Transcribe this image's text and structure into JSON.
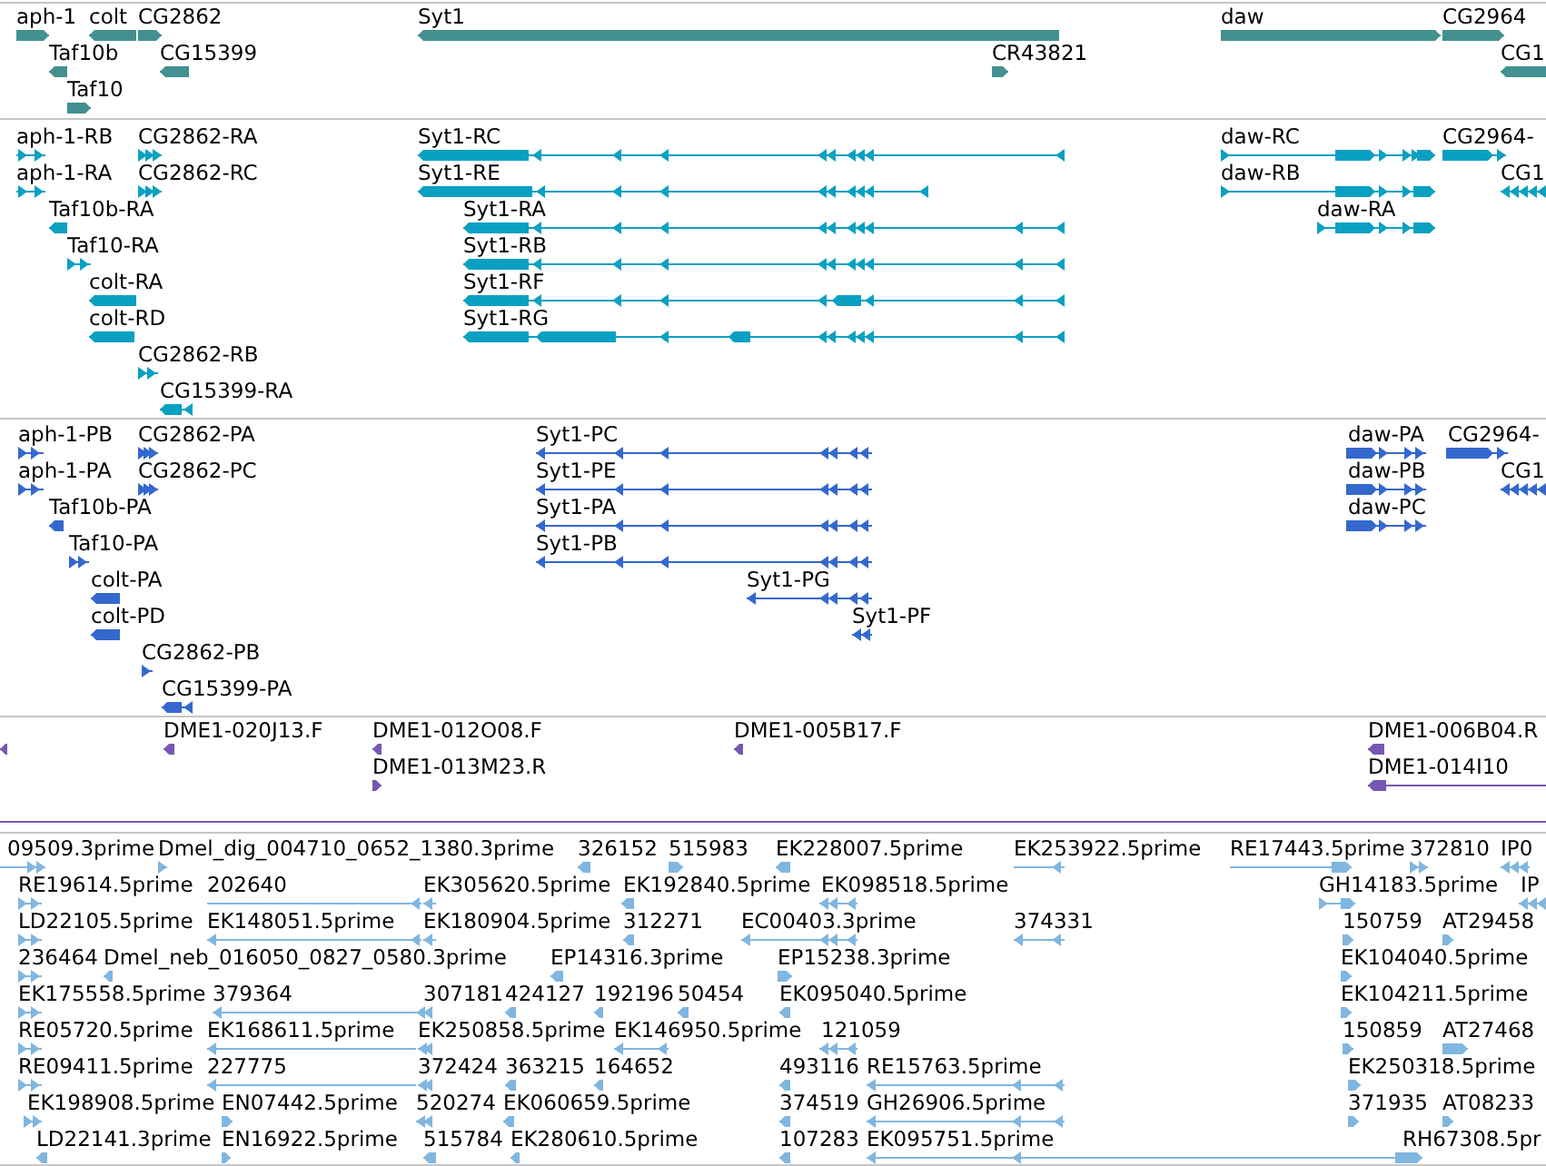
{
  "tracks": [
    {
      "kind": "gene",
      "features": [
        {
          "label": "aph-1",
          "reverse": false
        },
        {
          "label": "colt",
          "reverse": true
        },
        {
          "label": "CG2862",
          "reverse": false
        },
        {
          "label": "Syt1",
          "reverse": true
        },
        {
          "label": "daw",
          "reverse": false
        },
        {
          "label": "CG2964",
          "reverse": false
        },
        {
          "label": "Taf10b",
          "reverse": true
        },
        {
          "label": "CG15399",
          "reverse": true
        },
        {
          "label": "CR43821",
          "reverse": false
        },
        {
          "label": "CG1",
          "reverse": true
        },
        {
          "label": "Taf10",
          "reverse": false
        }
      ]
    },
    {
      "kind": "mrna",
      "features": [
        {
          "label": "aph-1-RB",
          "reverse": false
        },
        {
          "label": "CG2862-RA",
          "reverse": false
        },
        {
          "label": "Syt1-RC",
          "reverse": true
        },
        {
          "label": "daw-RC",
          "reverse": false
        },
        {
          "label": "CG2964-",
          "reverse": false
        },
        {
          "label": "aph-1-RA",
          "reverse": false
        },
        {
          "label": "CG2862-RC",
          "reverse": false
        },
        {
          "label": "Syt1-RE",
          "reverse": true
        },
        {
          "label": "daw-RB",
          "reverse": false
        },
        {
          "label": "CG1",
          "reverse": true
        },
        {
          "label": "Taf10b-RA",
          "reverse": true
        },
        {
          "label": "Syt1-RA",
          "reverse": true
        },
        {
          "label": "daw-RA",
          "reverse": false
        },
        {
          "label": "Taf10-RA",
          "reverse": false
        },
        {
          "label": "Syt1-RB",
          "reverse": true
        },
        {
          "label": "colt-RA",
          "reverse": true
        },
        {
          "label": "Syt1-RF",
          "reverse": true
        },
        {
          "label": "colt-RD",
          "reverse": true
        },
        {
          "label": "Syt1-RG",
          "reverse": true
        },
        {
          "label": "CG2862-RB",
          "reverse": false
        },
        {
          "label": "CG15399-RA",
          "reverse": true
        }
      ]
    },
    {
      "kind": "protein",
      "features": [
        {
          "label": "aph-1-PB",
          "reverse": false
        },
        {
          "label": "CG2862-PA",
          "reverse": false
        },
        {
          "label": "Syt1-PC",
          "reverse": true
        },
        {
          "label": "daw-PA",
          "reverse": false
        },
        {
          "label": "CG2964-",
          "reverse": false
        },
        {
          "label": "aph-1-PA",
          "reverse": false
        },
        {
          "label": "CG2862-PC",
          "reverse": false
        },
        {
          "label": "Syt1-PE",
          "reverse": true
        },
        {
          "label": "daw-PB",
          "reverse": false
        },
        {
          "label": "CG1",
          "reverse": true
        },
        {
          "label": "Taf10b-PA",
          "reverse": true
        },
        {
          "label": "Syt1-PA",
          "reverse": true
        },
        {
          "label": "daw-PC",
          "reverse": false
        },
        {
          "label": "Taf10-PA",
          "reverse": false
        },
        {
          "label": "Syt1-PB",
          "reverse": true
        },
        {
          "label": "colt-PA",
          "reverse": true
        },
        {
          "label": "Syt1-PG",
          "reverse": true
        },
        {
          "label": "colt-PD",
          "reverse": true
        },
        {
          "label": "Syt1-PF",
          "reverse": true
        },
        {
          "label": "CG2862-PB",
          "reverse": false
        },
        {
          "label": "CG15399-PA",
          "reverse": true
        }
      ]
    },
    {
      "kind": "clone_end",
      "features": [
        {
          "reverse": true
        },
        {
          "label": "DME1-020J13.F",
          "reverse": true
        },
        {
          "label": "DME1-012O08.F",
          "reverse": true
        },
        {
          "label": "DME1-005B17.F",
          "reverse": true
        },
        {
          "label": "DME1-006B04.R",
          "reverse": true
        },
        {
          "label": "DME1-013M23.R",
          "reverse": false
        },
        {
          "label": "DME1-014I10",
          "reverse": true
        }
      ]
    },
    {
      "kind": "est",
      "features": [
        {
          "label": "09509.3prime",
          "reverse": false
        },
        {
          "label": "Dmel_dig_004710_0652_1380.3prime",
          "reverse": false
        },
        {
          "label": "326152",
          "reverse": true
        },
        {
          "label": "515983",
          "reverse": false
        },
        {
          "label": "EK228007.5prime",
          "reverse": true
        },
        {
          "label": "EK253922.5prime",
          "reverse": true
        },
        {
          "label": "RE17443.5prime",
          "reverse": false
        },
        {
          "label": "372810",
          "reverse": false
        },
        {
          "label": "IP0",
          "reverse": true
        },
        {
          "label": "RE19614.5prime",
          "reverse": false
        },
        {
          "label": "202640",
          "reverse": true
        },
        {
          "label": "EK305620.5prime",
          "reverse": true
        },
        {
          "label": "EK192840.5prime",
          "reverse": true
        },
        {
          "label": "EK098518.5prime",
          "reverse": true
        },
        {
          "label": "GH14183.5prime",
          "reverse": false
        },
        {
          "label": "IP",
          "reverse": true
        },
        {
          "label": "LD22105.5prime",
          "reverse": false
        },
        {
          "label": "EK148051.5prime",
          "reverse": true
        },
        {
          "label": "EK180904.5prime",
          "reverse": true
        },
        {
          "label": "312271",
          "reverse": true
        },
        {
          "label": "EC00403.3prime",
          "reverse": true
        },
        {
          "label": "374331",
          "reverse": true
        },
        {
          "label": "150759",
          "reverse": false
        },
        {
          "label": "AT29458",
          "reverse": false
        },
        {
          "label": "236464",
          "reverse": false
        },
        {
          "label": "Dmel_neb_016050_0827_0580.3prime",
          "reverse": true
        },
        {
          "label": "EP14316.3prime",
          "reverse": true
        },
        {
          "label": "EP15238.3prime",
          "reverse": false
        },
        {
          "label": "EK104040.5prime",
          "reverse": false
        },
        {
          "label": "EK175558.5prime",
          "reverse": false
        },
        {
          "label": "379364",
          "reverse": true
        },
        {
          "label": "307181",
          "reverse": true
        },
        {
          "label": "424127",
          "reverse": true
        },
        {
          "label": "192196",
          "reverse": true
        },
        {
          "label": "50454",
          "reverse": true
        },
        {
          "label": "EK095040.5prime",
          "reverse": true
        },
        {
          "label": "EK104211.5prime",
          "reverse": false
        },
        {
          "label": "RE05720.5prime",
          "reverse": false
        },
        {
          "label": "EK168611.5prime",
          "reverse": true
        },
        {
          "label": "EK250858.5prime",
          "reverse": true
        },
        {
          "label": "EK146950.5prime",
          "reverse": true
        },
        {
          "label": "121059",
          "reverse": true
        },
        {
          "label": "150859",
          "reverse": false
        },
        {
          "label": "AT27468",
          "reverse": false
        },
        {
          "label": "RE09411.5prime",
          "reverse": false
        },
        {
          "label": "227775",
          "reverse": true
        },
        {
          "label": "372424",
          "reverse": true
        },
        {
          "label": "363215",
          "reverse": true
        },
        {
          "label": "164652",
          "reverse": true
        },
        {
          "label": "493116",
          "reverse": true
        },
        {
          "label": "RE15763.5prime",
          "reverse": true
        },
        {
          "label": "EK250318.5prime",
          "reverse": false
        },
        {
          "label": "EK198908.5prime",
          "reverse": false
        },
        {
          "label": "EN07442.5prime",
          "reverse": false
        },
        {
          "label": "520274",
          "reverse": true
        },
        {
          "label": "EK060659.5prime",
          "reverse": true
        },
        {
          "label": "374519",
          "reverse": true
        },
        {
          "label": "GH26906.5prime",
          "reverse": true
        },
        {
          "label": "371935",
          "reverse": false
        },
        {
          "label": "AT08233",
          "reverse": false
        },
        {
          "label": "LD22141.3prime",
          "reverse": true
        },
        {
          "label": "EN16922.5prime",
          "reverse": false
        },
        {
          "label": "515784",
          "reverse": true
        },
        {
          "label": "EK280610.5prime",
          "reverse": true
        },
        {
          "label": "107283",
          "reverse": true
        },
        {
          "label": "EK095751.5prime",
          "reverse": true
        },
        {
          "label": "RH67308.5pr",
          "reverse": false
        }
      ]
    }
  ]
}
